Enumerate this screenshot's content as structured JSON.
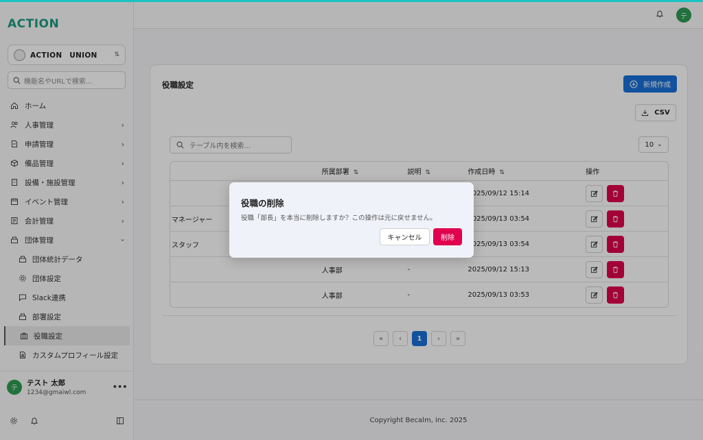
{
  "app": {
    "logo": "ACTION"
  },
  "sidebar": {
    "org": "ACTION　UNION",
    "search_placeholder": "機能名やURLで検索...",
    "items": [
      {
        "label": "ホーム",
        "icon": "home-icon",
        "expandable": false
      },
      {
        "label": "人事管理",
        "icon": "users-icon",
        "expandable": true
      },
      {
        "label": "申請管理",
        "icon": "document-icon",
        "expandable": true
      },
      {
        "label": "備品管理",
        "icon": "box-icon",
        "expandable": true
      },
      {
        "label": "設備・施設管理",
        "icon": "building-icon",
        "expandable": true
      },
      {
        "label": "イベント管理",
        "icon": "calendar-icon",
        "expandable": true
      },
      {
        "label": "会計管理",
        "icon": "ledger-icon",
        "expandable": true
      },
      {
        "label": "団体管理",
        "icon": "group-icon",
        "expandable": true,
        "expanded": true
      }
    ],
    "subitems": [
      {
        "label": "団体統計データ",
        "icon": "chart-icon"
      },
      {
        "label": "団体設定",
        "icon": "gear-icon"
      },
      {
        "label": "Slack連携",
        "icon": "chat-icon"
      },
      {
        "label": "部署設定",
        "icon": "department-icon"
      },
      {
        "label": "役職設定",
        "icon": "briefcase-icon",
        "active": true
      },
      {
        "label": "カスタムプロフィール設定",
        "icon": "profile-doc-icon"
      }
    ],
    "user": {
      "avatar": "テ",
      "name": "テスト 太郎",
      "email": "1234@gmaiwl.com"
    }
  },
  "header": {
    "avatar": "テ"
  },
  "main": {
    "title": "役職設定",
    "new_button": "新規作成",
    "csv_button": "CSV",
    "table_search_placeholder": "テーブル内を検索...",
    "per_page": "10",
    "columns": [
      "",
      "所属部署",
      "説明",
      "作成日時",
      "操作"
    ],
    "rows": [
      {
        "name": "",
        "dept": "",
        "desc": "",
        "created": "2025/09/12 15:14"
      },
      {
        "name": "マネージャー",
        "dept": "",
        "desc": "",
        "created": "2025/09/13 03:54"
      },
      {
        "name": "スタッフ",
        "dept": "",
        "desc": "",
        "created": "2025/09/13 03:54"
      },
      {
        "name": "",
        "dept": "人事部",
        "desc": "-",
        "created": "2025/09/12 15:13"
      },
      {
        "name": "",
        "dept": "人事部",
        "desc": "-",
        "created": "2025/09/13 03:53"
      }
    ],
    "pager": {
      "first": "«",
      "prev": "‹",
      "current": "1",
      "next": "›",
      "last": "»"
    }
  },
  "footer": "Copyright Becalm, inc. 2025",
  "dialog": {
    "title": "役職の削除",
    "message": "役職「部長」を本当に削除しますか？この操作は元に戻せません。",
    "cancel": "キャンセル",
    "delete": "削除"
  },
  "colors": {
    "accent": "#1a6fd8",
    "danger": "#e0004d",
    "brand": "#1d9b86",
    "topline": "#19c3c3"
  }
}
